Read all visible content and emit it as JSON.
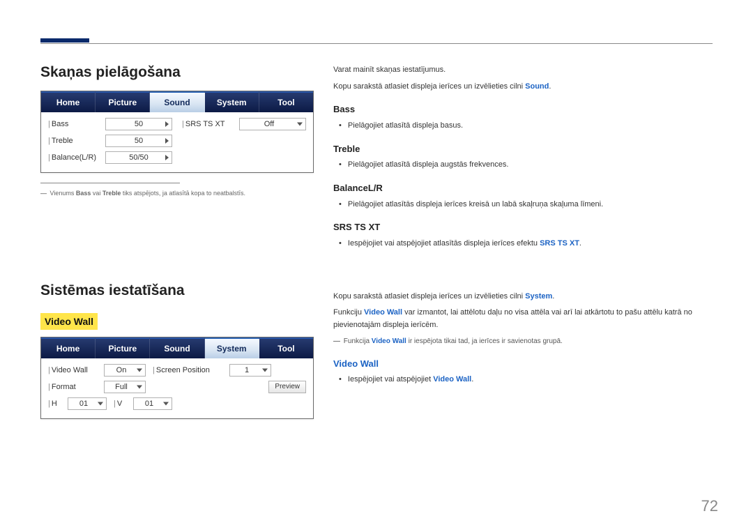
{
  "page_number": "72",
  "section1": {
    "title": "Skaņas pielāgošana",
    "tabs": [
      "Home",
      "Picture",
      "Sound",
      "System",
      "Tool"
    ],
    "active_tab_index": 2,
    "rows_left": [
      {
        "label": "Bass",
        "value": "50"
      },
      {
        "label": "Treble",
        "value": "50"
      },
      {
        "label": "Balance(L/R)",
        "value": "50/50"
      }
    ],
    "rows_right": [
      {
        "label": "SRS TS XT",
        "value": "Off"
      }
    ],
    "footnote_dash": "―",
    "footnote_pre": " Vienums ",
    "footnote_b1": "Bass",
    "footnote_mid": " vai ",
    "footnote_b2": "Treble",
    "footnote_post": " tiks atspējots, ja atlasītā kopa to neatbalstīs."
  },
  "section2": {
    "title": "Sistēmas iestatīšana",
    "highlight": "Video Wall",
    "tabs": [
      "Home",
      "Picture",
      "Sound",
      "System",
      "Tool"
    ],
    "active_tab_index": 3,
    "row1": [
      {
        "label": "Video Wall",
        "value": "On"
      },
      {
        "label": "Screen Position",
        "value": "1"
      }
    ],
    "row2": {
      "label": "Format",
      "value": "Full",
      "button": "Preview"
    },
    "row3": [
      {
        "label": "H",
        "value": "01"
      },
      {
        "label": "V",
        "value": "01"
      }
    ]
  },
  "right1": {
    "intro1": "Varat mainīt skaņas iestatījumus.",
    "intro2_pre": "Kopu sarakstā atlasiet displeja ierīces un izvēlieties cilni ",
    "intro2_key": "Sound",
    "intro2_post": ".",
    "bass_h": "Bass",
    "bass_li": "Pielāgojiet atlasītā displeja basus.",
    "treble_h": "Treble",
    "treble_li": "Pielāgojiet atlasītā displeja augstās frekvences.",
    "bal_h": "BalanceL/R",
    "bal_li": "Pielāgojiet atlasītās displeja ierīces kreisā un labā skaļruņa skaļuma līmeni.",
    "srs_h": "SRS TS XT",
    "srs_li_pre": "Iespējojiet vai atspējojiet atlasītās displeja ierīces efektu ",
    "srs_key": "SRS TS XT",
    "srs_li_post": "."
  },
  "right2": {
    "intro_pre": "Kopu sarakstā atlasiet displeja ierīces un izvēlieties cilni ",
    "intro_key": "System",
    "intro_post": ".",
    "para2_pre": "Funkciju ",
    "para2_key": "Video Wall",
    "para2_post": " var izmantot, lai attēlotu daļu no visa attēla vai arī lai atkārtotu to pašu attēlu katrā no pievienotajām displeja ierīcēm.",
    "note_dash": "―",
    "note_pre": " Funkcija ",
    "note_key": "Video Wall",
    "note_post": " ir iespējota tikai tad, ja ierīces ir savienotas grupā.",
    "vw_h": "Video Wall",
    "vw_li_pre": "Iespējojiet vai atspējojiet ",
    "vw_key": "Video Wall",
    "vw_li_post": "."
  }
}
